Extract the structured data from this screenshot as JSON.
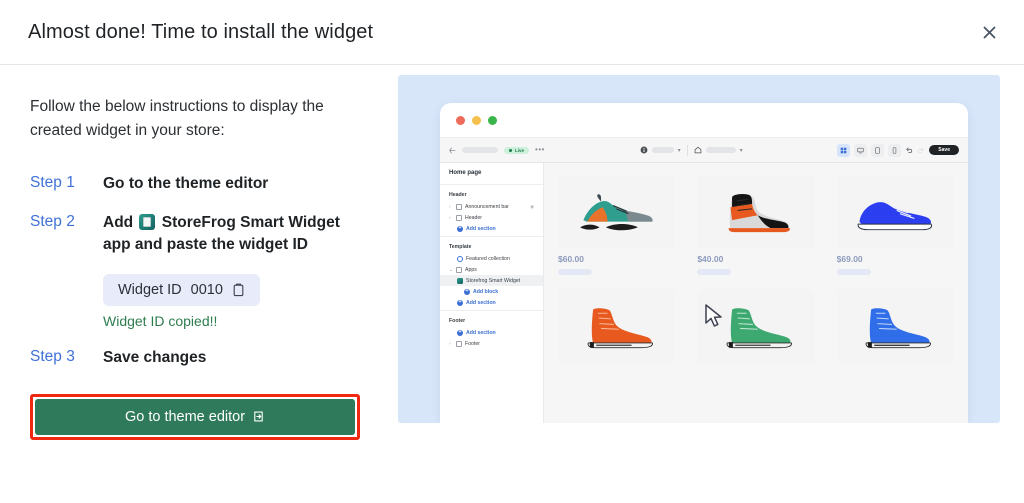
{
  "modal": {
    "title": "Almost done! Time to install the widget",
    "close_icon": "close-icon"
  },
  "instructions": {
    "intro": "Follow the below instructions to display the created widget in your store:",
    "steps": [
      {
        "label": "Step 1",
        "text": "Go to the theme editor"
      },
      {
        "label": "Step 2",
        "text_before": "Add",
        "app_name": "StoreFrog Smart Widget",
        "text_after": "app and paste the widget ID"
      },
      {
        "label": "Step 3",
        "text": "Save changes"
      }
    ],
    "widget_id_label": "Widget ID",
    "widget_id_value": "0010",
    "copy_icon": "clipboard-icon",
    "copied_message": "Widget ID copied!!",
    "cta_label": "Go to theme editor",
    "cta_icon": "external-link-icon"
  },
  "colors": {
    "step_blue": "#3f72d8",
    "cta_green": "#2f7a5b",
    "highlight_red": "#f0280f",
    "copied_green": "#2e7d4f",
    "preview_bg": "#d8e6fa",
    "price_blue": "#8e9bbd"
  },
  "preview": {
    "traffic_lights": [
      "red",
      "yellow",
      "green"
    ],
    "toolbar": {
      "back_icon": "back-arrow-icon",
      "live_badge": "Live",
      "more_icon": "ellipsis-icon",
      "selector_1_icon": "info-icon",
      "selector_2_icon": "home-icon",
      "chevron_icon": "chevron-down-icon",
      "view_icons": [
        "grid-icon",
        "desktop-icon",
        "tablet-icon",
        "mobile-icon"
      ],
      "undo_icon": "undo-icon",
      "redo_icon": "redo-icon",
      "save_label": "Save"
    },
    "sidebar": {
      "page_title": "Home page",
      "sections": [
        {
          "group": "Header",
          "items": [
            {
              "label": "Announcement bar",
              "type": "section",
              "caret": true,
              "eye": true
            },
            {
              "label": "Header",
              "type": "section",
              "caret": true
            },
            {
              "label": "Add section",
              "type": "add"
            }
          ]
        },
        {
          "group": "Template",
          "items": [
            {
              "label": "Featured collection",
              "type": "section"
            },
            {
              "label": "Apps",
              "type": "section",
              "caret": true
            },
            {
              "label": "Storefrog Smart Widget",
              "type": "app",
              "selected": true
            },
            {
              "label": "Add block",
              "type": "add",
              "indent": true
            },
            {
              "label": "Add section",
              "type": "add"
            }
          ]
        },
        {
          "group": "Footer",
          "items": [
            {
              "label": "Add section",
              "type": "add"
            },
            {
              "label": "Footer",
              "type": "section",
              "caret": true
            }
          ]
        }
      ]
    },
    "products": [
      {
        "price": "$60.00",
        "shoe": "teal-runner"
      },
      {
        "price": "$40.00",
        "shoe": "orange-hightop"
      },
      {
        "price": "$69.00",
        "shoe": "blue-sneaker"
      },
      {
        "price": "",
        "shoe": "orange-converse"
      },
      {
        "price": "",
        "shoe": "green-converse"
      },
      {
        "price": "",
        "shoe": "blue-converse"
      }
    ],
    "cursor_icon": "mouse-pointer-icon"
  }
}
